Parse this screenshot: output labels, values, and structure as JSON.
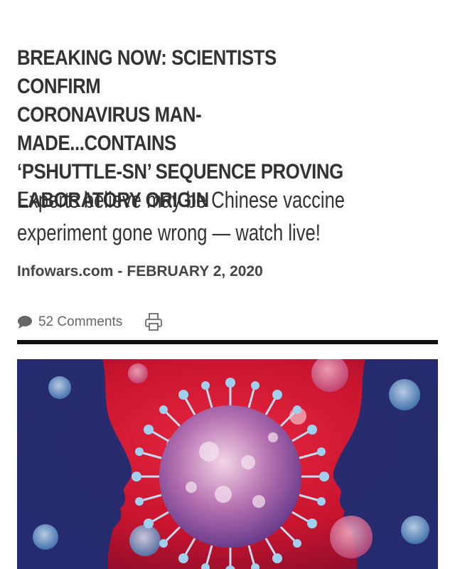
{
  "article": {
    "headline": "BREAKING NOW: SCIENTISTS CONFIRM\nCORONAVIRUS MAN-MADE...CONTAINS\n‘PSHUTTLE-SN’ SEQUENCE PROVING\nLABORATORY ORIGIN",
    "subheadline": "Experts believe may be Chinese vaccine\nexperiment gone wrong — watch live!",
    "source": "Infowars.com",
    "separator": "-",
    "date": "FEBRUARY 2, 2020",
    "comments_label": "52 Comments"
  },
  "icons": {
    "comments": "speech-bubble-icon",
    "print": "printer-icon"
  },
  "colors": {
    "text": "#333333",
    "meta": "#666666",
    "divider": "#111111",
    "hero_red": "#d21a3a",
    "hero_blue": "#1e2f7a"
  }
}
